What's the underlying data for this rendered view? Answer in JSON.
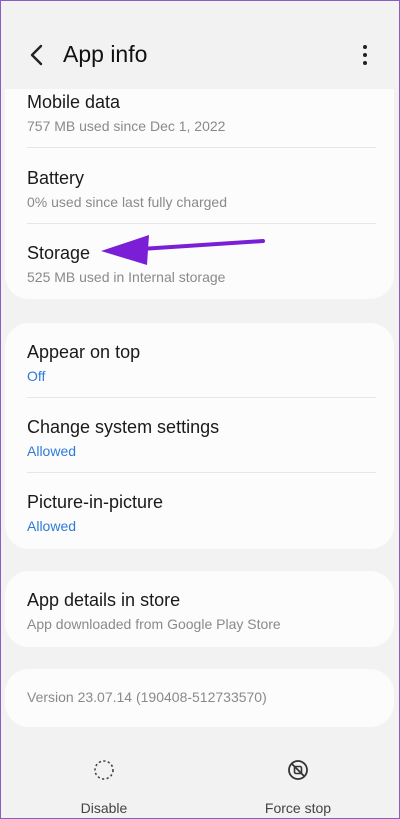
{
  "header": {
    "title": "App info"
  },
  "usage": [
    {
      "label": "Mobile data",
      "sub": "757 MB used since Dec 1, 2022"
    },
    {
      "label": "Battery",
      "sub": "0% used since last fully charged"
    },
    {
      "label": "Storage",
      "sub": "525 MB used in Internal storage"
    }
  ],
  "permissions": [
    {
      "label": "Appear on top",
      "sub": "Off"
    },
    {
      "label": "Change system settings",
      "sub": "Allowed"
    },
    {
      "label": "Picture-in-picture",
      "sub": "Allowed"
    }
  ],
  "store": {
    "label": "App details in store",
    "sub": "App downloaded from Google Play Store"
  },
  "version": "Version 23.07.14 (190408-512733570)",
  "bottom": {
    "disable": "Disable",
    "force_stop": "Force stop"
  },
  "colors": {
    "accent_blue": "#2e7bd6",
    "arrow": "#7a1fd6"
  },
  "icons": {
    "back": "back-arrow-icon",
    "more": "more-vert-icon",
    "disable": "disable-icon",
    "force_stop": "force-stop-icon"
  }
}
